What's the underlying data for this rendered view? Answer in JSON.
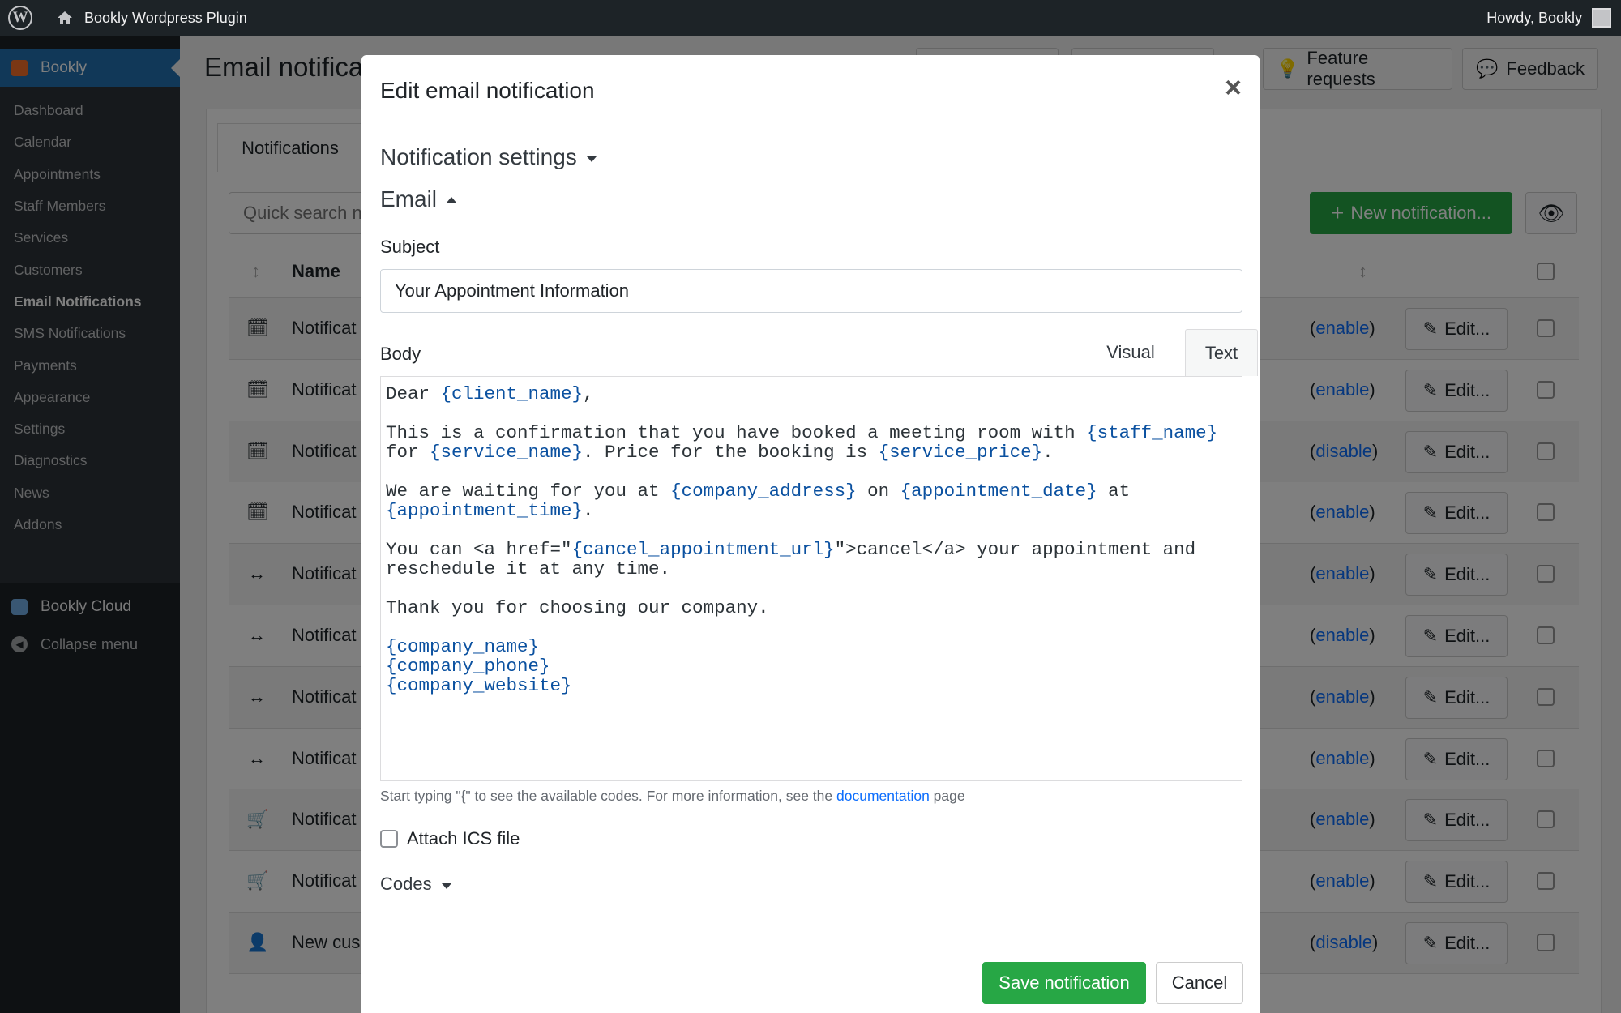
{
  "adminbar": {
    "site_name": "Bookly Wordpress Plugin",
    "howdy": "Howdy, Bookly"
  },
  "sidebar": {
    "brand": "Bookly",
    "items": [
      {
        "label": "Dashboard"
      },
      {
        "label": "Calendar"
      },
      {
        "label": "Appointments"
      },
      {
        "label": "Staff Members"
      },
      {
        "label": "Services"
      },
      {
        "label": "Customers"
      },
      {
        "label": "Email Notifications"
      },
      {
        "label": "SMS Notifications"
      },
      {
        "label": "Payments"
      },
      {
        "label": "Appearance"
      },
      {
        "label": "Settings"
      },
      {
        "label": "Diagnostics"
      },
      {
        "label": "News"
      },
      {
        "label": "Addons"
      }
    ],
    "current": "Email Notifications",
    "cloud": "Bookly Cloud",
    "collapse": "Collapse menu"
  },
  "page": {
    "title": "Email notifica",
    "feature_requests": "Feature requests",
    "feedback": "Feedback",
    "tab": "Notifications",
    "search_placeholder": "Quick search n",
    "new_notification": "New notification...",
    "col_name": "Name",
    "edit_label": "Edit..."
  },
  "rows": [
    {
      "icon": "calendar-check-icon",
      "name": "Notificat",
      "toggle": "enable"
    },
    {
      "icon": "calendar-check-icon",
      "name": "Notificat",
      "toggle": "enable"
    },
    {
      "icon": "calendar-check-icon",
      "name": "Notificat",
      "toggle": "disable"
    },
    {
      "icon": "calendar-check-icon",
      "name": "Notificat",
      "toggle": "enable"
    },
    {
      "icon": "arrows-horizontal-icon",
      "name": "Notificat",
      "toggle": "enable"
    },
    {
      "icon": "arrows-horizontal-icon",
      "name": "Notificat",
      "toggle": "enable"
    },
    {
      "icon": "arrows-horizontal-icon",
      "name": "Notificat",
      "toggle": "enable"
    },
    {
      "icon": "arrows-horizontal-icon",
      "name": "Notificat",
      "toggle": "enable"
    },
    {
      "icon": "cart-icon",
      "name": "Notificat",
      "toggle": "enable"
    },
    {
      "icon": "cart-icon",
      "name": "Notificat",
      "toggle": "enable"
    },
    {
      "icon": "user-plus-icon",
      "name": "New cus",
      "toggle": "disable"
    }
  ],
  "modal": {
    "title": "Edit email notification",
    "close": "×",
    "settings_toggle": "Notification settings",
    "email_toggle": "Email",
    "subject_label": "Subject",
    "subject_value": "Your Appointment Information",
    "body_label": "Body",
    "tab_visual": "Visual",
    "tab_text": "Text",
    "body_lines": [
      [
        {
          "t": "Dear "
        },
        {
          "c": "{client_name}"
        },
        {
          "t": ","
        }
      ],
      [],
      [
        {
          "t": "This is a confirmation that you have booked a meeting room with "
        },
        {
          "c": "{staff_name}"
        }
      ],
      [
        {
          "t": "for "
        },
        {
          "c": "{service_name}"
        },
        {
          "t": ". Price for the booking is "
        },
        {
          "c": "{service_price}"
        },
        {
          "t": "."
        }
      ],
      [],
      [
        {
          "t": "We are waiting for you at "
        },
        {
          "c": "{company_address}"
        },
        {
          "t": " on "
        },
        {
          "c": "{appointment_date}"
        },
        {
          "t": " at"
        }
      ],
      [
        {
          "c": "{appointment_time}"
        },
        {
          "t": "."
        }
      ],
      [],
      [
        {
          "t": "You can <a href=\""
        },
        {
          "c": "{cancel_appointment_url}"
        },
        {
          "t": "\">cancel</a> your appointment and"
        }
      ],
      [
        {
          "t": "reschedule it at any time."
        }
      ],
      [],
      [
        {
          "t": "Thank you for choosing our company."
        }
      ],
      [],
      [
        {
          "c": "{company_name}"
        }
      ],
      [
        {
          "c": "{company_phone}"
        }
      ],
      [
        {
          "c": "{company_website}"
        }
      ]
    ],
    "help_prefix": "Start typing \"{\" to see the available codes. For more information, see the ",
    "help_link": "documentation",
    "help_suffix": " page",
    "ics_label": "Attach ICS file",
    "codes_toggle": "Codes",
    "save": "Save notification",
    "cancel": "Cancel"
  },
  "colors": {
    "accent": "#2271b1",
    "success": "#27a745",
    "code": "#0b51a0",
    "link": "#0d6efd"
  }
}
